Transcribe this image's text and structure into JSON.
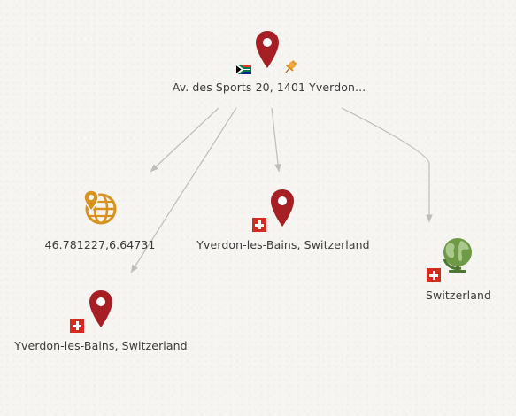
{
  "nodes": {
    "address": {
      "label": "Av. des Sports 20, 1401 Yverdon...",
      "icon": "map-pin-icon",
      "flag": "south-africa-flag-icon",
      "badge": "pushpin-icon"
    },
    "coordinates": {
      "label": "46.781227,6.64731",
      "icon": "globe-pin-icon"
    },
    "city_center": {
      "label": "Yverdon-les-Bains, Switzerland",
      "icon": "map-pin-icon",
      "flag": "switzerland-flag-icon"
    },
    "city_left": {
      "label": "Yverdon-les-Bains, Switzerland",
      "icon": "map-pin-icon",
      "flag": "switzerland-flag-icon"
    },
    "country": {
      "label": "Switzerland",
      "icon": "globe-icon",
      "flag": "switzerland-flag-icon"
    }
  },
  "colors": {
    "pin": "#a51f24",
    "globe_pin": "#d8921f",
    "globe": "#5b8a3a",
    "edge": "#bdbdbd",
    "swiss_red": "#d52b1e"
  }
}
